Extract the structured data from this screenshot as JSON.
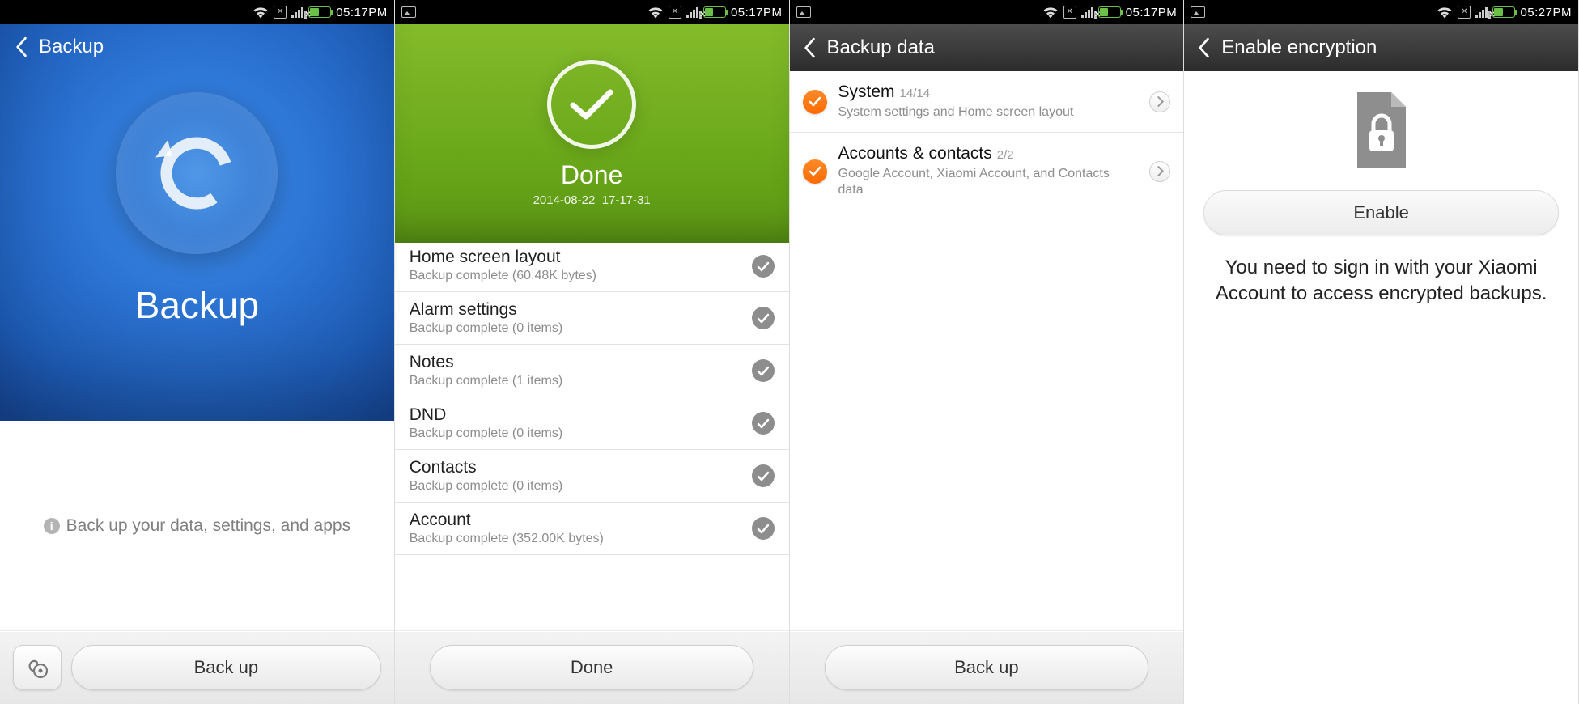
{
  "status": {
    "time_a": "05:17PM",
    "time_b": "05:27PM"
  },
  "screen1": {
    "title": "Backup",
    "hero_label": "Backup",
    "hint": "Back up your data, settings, and apps",
    "button": "Back up"
  },
  "screen2": {
    "done_title": "Done",
    "done_timestamp": "2014-08-22_17-17-31",
    "items": [
      {
        "title": "Home screen layout",
        "sub": "Backup complete (60.48K  bytes)"
      },
      {
        "title": "Alarm settings",
        "sub": "Backup complete (0  items)"
      },
      {
        "title": "Notes",
        "sub": "Backup complete (1  items)"
      },
      {
        "title": "DND",
        "sub": "Backup complete (0  items)"
      },
      {
        "title": "Contacts",
        "sub": "Backup complete (0  items)"
      },
      {
        "title": "Account",
        "sub": "Backup complete (352.00K  bytes)"
      }
    ],
    "button": "Done"
  },
  "screen3": {
    "title": "Backup data",
    "items": [
      {
        "title": "System",
        "count": "14/14",
        "sub": "System settings and Home screen layout"
      },
      {
        "title": "Accounts & contacts",
        "count": "2/2",
        "sub": "Google Account, Xiaomi Account, and Contacts data"
      }
    ],
    "button": "Back up"
  },
  "screen4": {
    "title": "Enable encryption",
    "button": "Enable",
    "message": "You need to sign in with your Xiaomi Account to access encrypted backups."
  }
}
